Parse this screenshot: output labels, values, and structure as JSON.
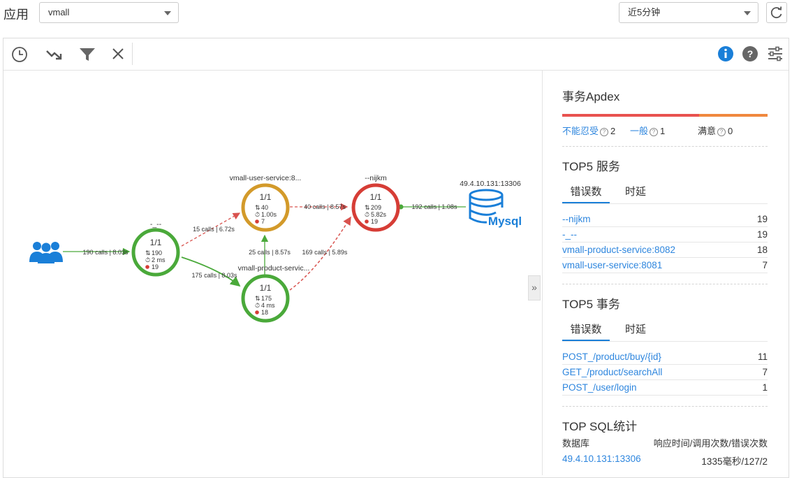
{
  "header": {
    "app_label": "应用",
    "app_select_value": "vmall",
    "time_select_value": "近5分钟"
  },
  "topology": {
    "edges": [
      {
        "id": "users-a",
        "label": "190 calls | 8.03s",
        "style": "solid",
        "color": "#4aa93a"
      },
      {
        "id": "a-user",
        "label": "15 calls | 6.72s",
        "style": "dashed",
        "color": "#d9534f"
      },
      {
        "id": "a-product",
        "label": "175 calls | 8.03s",
        "style": "solid",
        "color": "#4aa93a"
      },
      {
        "id": "product-user",
        "label": "25 calls | 8.57s",
        "style": "solid",
        "color": "#4aa93a"
      },
      {
        "id": "user-nijkm",
        "label": "40 calls | 8.57s",
        "style": "dashed",
        "color": "#d9534f"
      },
      {
        "id": "product-nijkm",
        "label": "169 calls | 5.89s",
        "style": "dashed",
        "color": "#d9534f"
      },
      {
        "id": "nijkm-mysql",
        "label": "192 calls | 1.08s",
        "style": "solid",
        "color": "#4aa93a"
      }
    ],
    "nodes": [
      {
        "id": "a",
        "name": "-_--",
        "ratio": "1/1",
        "calls": "190",
        "latency": "2 ms",
        "errors": "19",
        "color": "#4aa93a"
      },
      {
        "id": "user",
        "name": "vmall-user-service:8...",
        "ratio": "1/1",
        "calls": "40",
        "latency": "1.00s",
        "errors": "7",
        "color": "#d39a2a"
      },
      {
        "id": "product",
        "name": "vmall-product-servic...",
        "ratio": "1/1",
        "calls": "175",
        "latency": "4 ms",
        "errors": "18",
        "color": "#4aa93a"
      },
      {
        "id": "nijkm",
        "name": "--nijkm",
        "ratio": "1/1",
        "calls": "209",
        "latency": "5.82s",
        "errors": "19",
        "color": "#d63d36"
      }
    ],
    "database": {
      "name": "49.4.10.131:13306",
      "label": "Mysql",
      "color": "#1a7fd8"
    }
  },
  "apdex": {
    "title": "事务Apdex",
    "items": [
      {
        "label": "不能忍受",
        "count": "2"
      },
      {
        "label": "一般",
        "count": "1"
      },
      {
        "label": "满意",
        "count": "0"
      }
    ],
    "colors": {
      "bad": "#e8524f",
      "normal": "#f0883e"
    }
  },
  "top_services": {
    "title": "TOP5 服务",
    "tabs": [
      "错误数",
      "时延"
    ],
    "rows": [
      {
        "name": "--nijkm",
        "value": "19"
      },
      {
        "name": "-_--",
        "value": "19"
      },
      {
        "name": "vmall-product-service:8082",
        "value": "18"
      },
      {
        "name": "vmall-user-service:8081",
        "value": "7"
      }
    ]
  },
  "top_transactions": {
    "title": "TOP5 事务",
    "tabs": [
      "错误数",
      "时延"
    ],
    "rows": [
      {
        "name": "POST_/product/buy/{id}",
        "value": "11"
      },
      {
        "name": "GET_/product/searchAll",
        "value": "7"
      },
      {
        "name": "POST_/user/login",
        "value": "1"
      }
    ]
  },
  "top_sql": {
    "title": "TOP SQL统计",
    "col_db": "数据库",
    "col_stats": "响应时间/调用次数/错误次数",
    "rows": [
      {
        "db": "49.4.10.131:13306",
        "stats": "1335毫秒/127/2"
      }
    ]
  },
  "toolbar": {
    "icons": [
      "clock-icon",
      "trend-icon",
      "filter-icon",
      "close-icon",
      "info-icon",
      "help-icon",
      "settings-icon"
    ]
  },
  "accent_color": "#1a7fd8"
}
